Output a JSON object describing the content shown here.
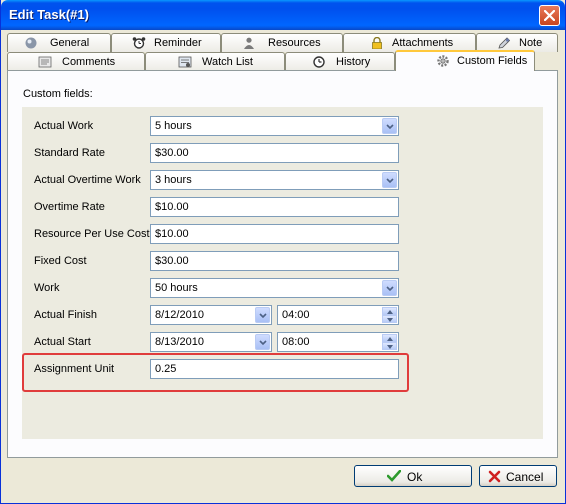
{
  "window": {
    "title": "Edit Task(#1)"
  },
  "tabs_row1": [
    {
      "label": "General",
      "icon": "sphere-icon"
    },
    {
      "label": "Reminder",
      "icon": "alarm-clock-icon"
    },
    {
      "label": "Resources",
      "icon": "person-icon"
    },
    {
      "label": "Attachments",
      "icon": "lock-icon"
    },
    {
      "label": "Note",
      "icon": "pencil-icon"
    }
  ],
  "tabs_row2": [
    {
      "label": "Comments",
      "icon": "comments-icon"
    },
    {
      "label": "Watch List",
      "icon": "watch-list-icon"
    },
    {
      "label": "History",
      "icon": "history-icon"
    },
    {
      "label": "Custom Fields",
      "icon": "gear-icon",
      "active": true
    }
  ],
  "panel": {
    "section_label": "Custom fields:"
  },
  "fields": [
    {
      "label": "Actual Work",
      "value": "5 hours",
      "type": "dropdown"
    },
    {
      "label": "Standard Rate",
      "value": "$30.00",
      "type": "text"
    },
    {
      "label": "Actual Overtime Work",
      "value": "3 hours",
      "type": "dropdown"
    },
    {
      "label": "Overtime Rate",
      "value": "$10.00",
      "type": "text"
    },
    {
      "label": "Resource Per Use Cost",
      "value": "$10.00",
      "type": "text"
    },
    {
      "label": "Fixed Cost",
      "value": "$30.00",
      "type": "text"
    },
    {
      "label": "Work",
      "value": "50 hours",
      "type": "dropdown"
    },
    {
      "label": "Actual Finish",
      "date": "8/12/2010",
      "time": "04:00",
      "type": "datetime"
    },
    {
      "label": "Actual Start",
      "date": "8/13/2010",
      "time": "08:00",
      "type": "datetime"
    },
    {
      "label": "Assignment Unit",
      "value": "0.25",
      "type": "text",
      "highlighted": true
    }
  ],
  "buttons": {
    "ok": "Ok",
    "cancel": "Cancel"
  },
  "colors": {
    "title_bar": "#0054e3",
    "highlight": "#e03c3c",
    "active_tab_accent": "#ffc83c"
  }
}
